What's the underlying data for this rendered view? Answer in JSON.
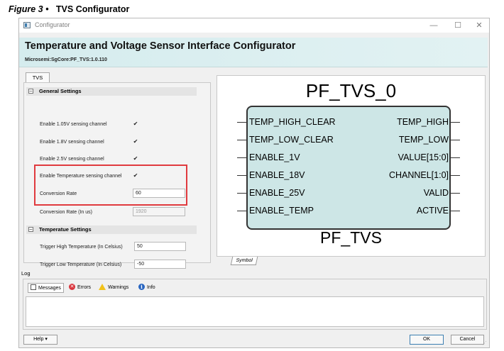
{
  "caption": {
    "figure": "Figure 3 •",
    "title": "TVS Configurator"
  },
  "window": {
    "title": "Configurator",
    "minimize": "—",
    "maximize": "☐",
    "close": "✕"
  },
  "header": {
    "title": "Temperature and Voltage Sensor Interface Configurator",
    "subtitle": "Microsemi:SgCore:PF_TVS:1.0.110"
  },
  "tabs": {
    "tvs": "TVS"
  },
  "general": {
    "heading": "General Settings",
    "collapse_glyph": "–",
    "rows": [
      {
        "label": "Enable 1.05V sensing channel",
        "checked": "✔"
      },
      {
        "label": "Enable 1.8V sensing channel",
        "checked": "✔"
      },
      {
        "label": "Enable 2.5V sensing channel",
        "checked": "✔"
      },
      {
        "label": "Enable Temperature  sensing channel",
        "checked": "✔"
      }
    ],
    "conversion_rate": {
      "label": "Conversion Rate",
      "value": "60"
    },
    "conversion_rate_us": {
      "label": "Conversion Rate (In us)",
      "value": "1920"
    }
  },
  "temperature": {
    "heading": "Temperatue Settings",
    "collapse_glyph": "–",
    "trigger_high": {
      "label": "Trigger High Temperature (In Celsius)",
      "value": "50"
    },
    "trigger_low": {
      "label": "Trigger Low Temperature (In Celsius)",
      "value": "-50"
    }
  },
  "symbol": {
    "instance_name": "PF_TVS_0",
    "component_name": "PF_TVS",
    "inputs": [
      "TEMP_HIGH_CLEAR",
      "TEMP_LOW_CLEAR",
      "ENABLE_1V",
      "ENABLE_18V",
      "ENABLE_25V",
      "ENABLE_TEMP"
    ],
    "outputs": [
      "TEMP_HIGH",
      "TEMP_LOW",
      "VALUE[15:0]",
      "CHANNEL[1:0]",
      "VALID",
      "ACTIVE"
    ],
    "tab_label": "Symbol",
    "box_color": "#cde6e6"
  },
  "log": {
    "label": "Log",
    "tabs": {
      "messages": "Messages",
      "errors": "Errors",
      "warnings": "Warnings",
      "info": "Info"
    },
    "error_glyph": "✕",
    "info_glyph": "i"
  },
  "footer": {
    "help": "Help",
    "help_arrow": "▾",
    "ok": "OK",
    "cancel": "Cancel"
  },
  "colors": {
    "highlight": "#e03a3e",
    "header_bg": "#d5ecee"
  }
}
